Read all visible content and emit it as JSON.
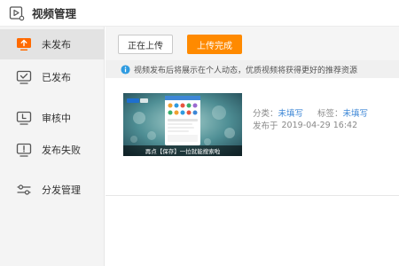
{
  "window": {
    "title": "视频管理"
  },
  "sidebar": {
    "items": [
      {
        "label": "未发布",
        "icon": "upload-monitor-icon"
      },
      {
        "label": "已发布",
        "icon": "check-monitor-icon"
      },
      {
        "label": "审核中",
        "icon": "pending-monitor-icon"
      },
      {
        "label": "发布失败",
        "icon": "alert-monitor-icon"
      },
      {
        "label": "分发管理",
        "icon": "sliders-icon"
      }
    ]
  },
  "toolbar": {
    "uploading_label": "正在上传",
    "uploaded_label": "上传完成"
  },
  "notice": {
    "icon": "info-icon",
    "text": "视频发布后将展示在个人动态，优质视频将获得更好的推荐资源"
  },
  "video": {
    "thumbnail_caption": "再点【保存】一拉就能搜索啦",
    "category_label": "分类：",
    "category_value": "未填写",
    "tags_label": "标签：",
    "tags_value": "未填写",
    "published_label": "发布于",
    "published_value": "2019-04-29 16:42"
  },
  "colors": {
    "accent": "#ff8a00",
    "link": "#3d87d6",
    "active_icon": "#ff6a00"
  }
}
